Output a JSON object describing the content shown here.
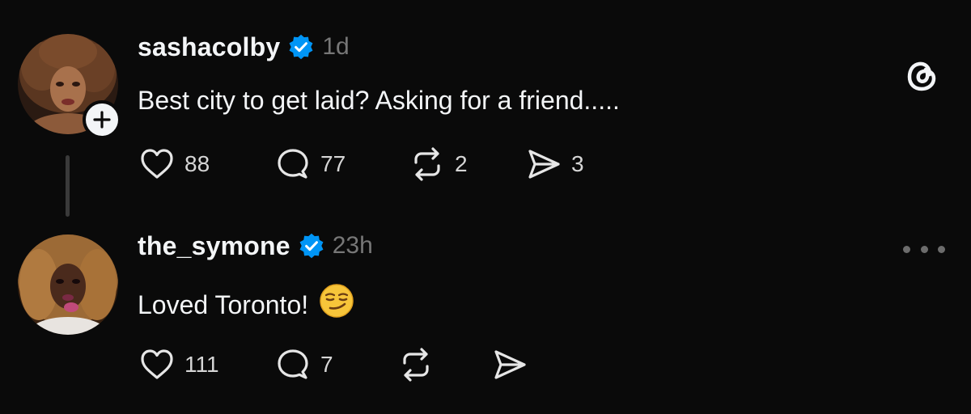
{
  "posts": [
    {
      "username": "sashacolby",
      "verified": true,
      "time": "1d",
      "text": "Best city to get laid? Asking for a friend.....",
      "likes": "88",
      "replies": "77",
      "reposts": "2",
      "shares": "3"
    },
    {
      "username": "the_symone",
      "verified": true,
      "time": "23h",
      "text": "Loved Toronto!",
      "emoji": "smirking-face",
      "likes": "111",
      "replies": "7",
      "reposts": "",
      "shares": ""
    }
  ],
  "icons": {
    "like": "heart-icon",
    "reply": "speech-bubble-icon",
    "repost": "repost-icon",
    "share": "paper-plane-icon",
    "verified": "verified-badge-icon",
    "follow": "plus-icon",
    "app": "threads-logo-icon",
    "more": "more-dots-icon"
  },
  "colors": {
    "background": "#0a0a0a",
    "text": "#f3f5f7",
    "muted": "#777777",
    "verified_blue": "#0095f6"
  }
}
